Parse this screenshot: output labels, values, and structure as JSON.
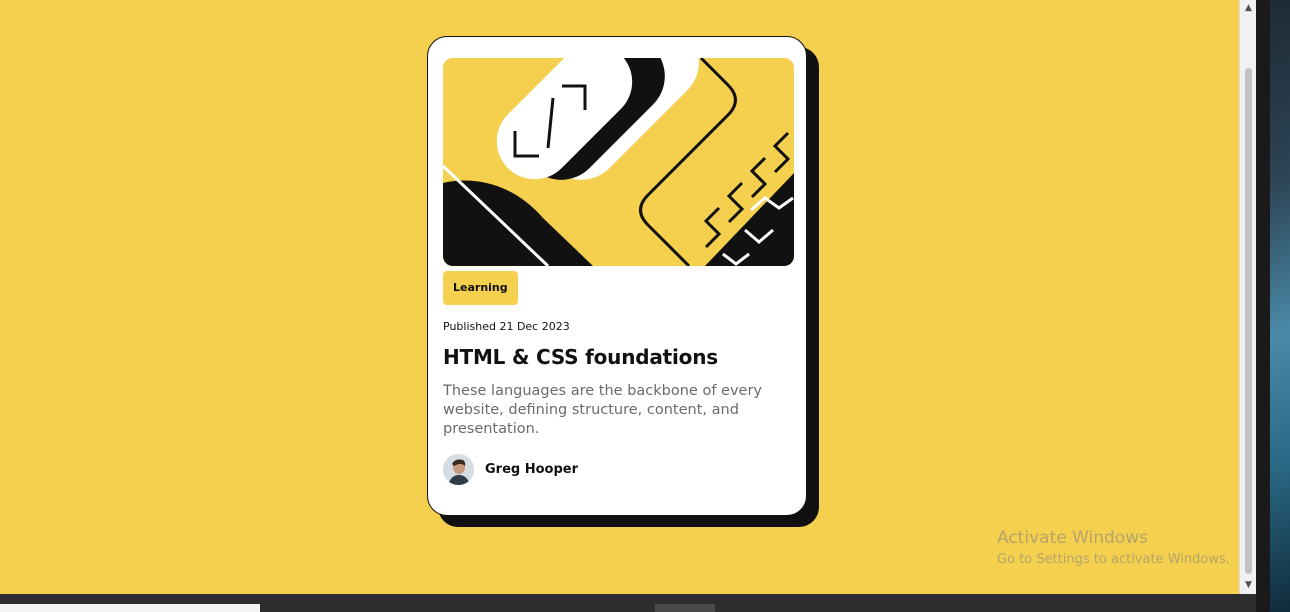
{
  "card": {
    "tag": "Learning",
    "published": "Published 21 Dec 2023",
    "title": "HTML & CSS foundations",
    "description": "These languages are the backbone of every website, defining structure, content, and presentation.",
    "author": "Greg Hooper"
  },
  "watermark": {
    "title": "Activate Windows",
    "subtitle": "Go to Settings to activate Windows."
  },
  "colors": {
    "background": "#f4d04e",
    "card": "#ffffff",
    "ink": "#111111",
    "muted_text": "#6b6b6b"
  },
  "icons": {
    "scroll_up": "chevron-up-icon",
    "scroll_down": "chevron-down-icon"
  }
}
